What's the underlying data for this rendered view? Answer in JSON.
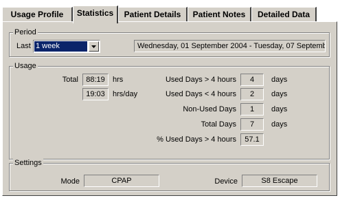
{
  "tabs": [
    {
      "label": "Usage Profile",
      "active": false
    },
    {
      "label": "Statistics",
      "active": true
    },
    {
      "label": "Patient Details",
      "active": false
    },
    {
      "label": "Patient Notes",
      "active": false
    },
    {
      "label": "Detailed Data",
      "active": false
    }
  ],
  "period": {
    "legend": "Period",
    "last_label": "Last",
    "selected": "1 week",
    "range": "Wednesday, 01 September 2004 - Tuesday, 07 September 2"
  },
  "usage": {
    "legend": "Usage",
    "total_label": "Total",
    "total_hours": "88:19",
    "total_unit": "hrs",
    "avg_hours": "19:03",
    "avg_unit": "hrs/day",
    "rows": [
      {
        "label": "Used Days > 4 hours",
        "value": "4",
        "unit": "days"
      },
      {
        "label": "Used Days < 4 hours",
        "value": "2",
        "unit": "days"
      },
      {
        "label": "Non-Used Days",
        "value": "1",
        "unit": "days"
      },
      {
        "label": "Total Days",
        "value": "7",
        "unit": "days"
      },
      {
        "label": "% Used Days > 4 hours",
        "value": "57.1",
        "unit": ""
      }
    ]
  },
  "settings": {
    "legend": "Settings",
    "mode_label": "Mode",
    "mode_value": "CPAP",
    "device_label": "Device",
    "device_value": "S8 Escape"
  }
}
